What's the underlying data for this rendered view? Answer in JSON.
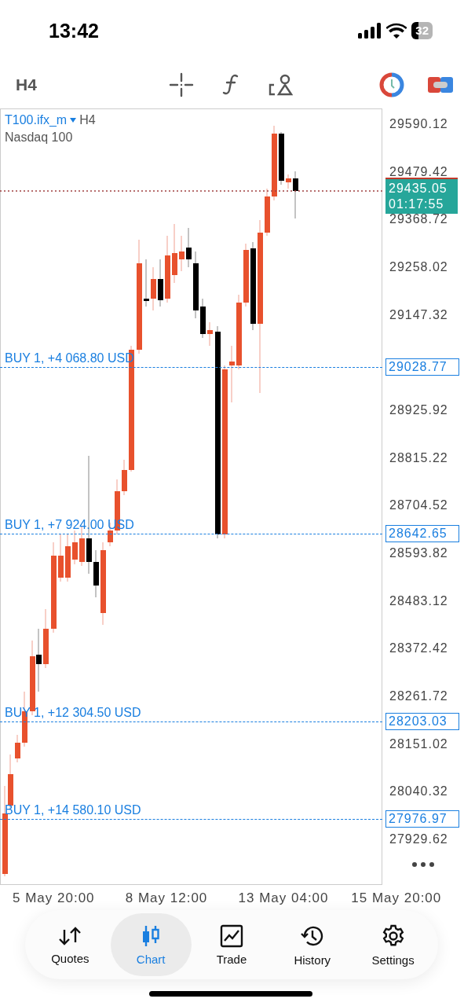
{
  "status_bar": {
    "time": "13:42",
    "battery": "32"
  },
  "toolbar": {
    "timeframe": "H4"
  },
  "chart": {
    "symbol": "T100.ifx_m",
    "timeframe": "H4",
    "description": "Nasdaq 100",
    "price_ticks": [
      "29590.12",
      "29479.42",
      "29368.72",
      "29258.02",
      "29147.32",
      "28925.92",
      "28815.22",
      "28704.52",
      "28593.82",
      "28483.12",
      "28372.42",
      "28261.72",
      "28151.02",
      "28040.32",
      "27929.62"
    ],
    "current_price": "29435.05",
    "countdown": "01:17:55",
    "orders": [
      {
        "label": "BUY 1, +4 068.80 USD",
        "price": "29028.77"
      },
      {
        "label": "BUY 1, +7 924.00 USD",
        "price": "28642.65"
      },
      {
        "label": "BUY 1, +12 304.50 USD",
        "price": "28203.03"
      },
      {
        "label": "BUY 1, +14 580.10 USD",
        "price": "27976.97"
      }
    ],
    "time_labels": [
      "5 May 20:00",
      "8 May 12:00",
      "13 May 04:00",
      "15 May 20:00"
    ]
  },
  "nav": {
    "items": [
      {
        "label": "Quotes",
        "selected": false
      },
      {
        "label": "Chart",
        "selected": true
      },
      {
        "label": "Trade",
        "selected": false
      },
      {
        "label": "History",
        "selected": false
      },
      {
        "label": "Settings",
        "selected": false
      }
    ]
  }
}
